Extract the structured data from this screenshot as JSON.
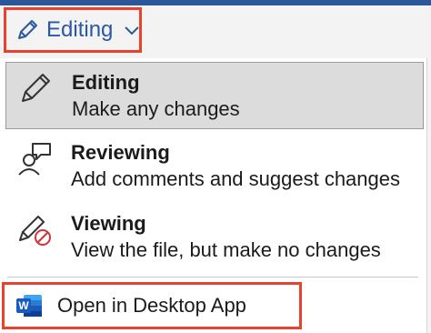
{
  "mode_button": {
    "label": "Editing",
    "icon": "pencil-icon",
    "chevron_icon": "chevron-down-icon",
    "accent_color": "#2a57a6",
    "highlight_color": "#e8422f"
  },
  "menu": {
    "items": [
      {
        "title": "Editing",
        "description": "Make any changes",
        "icon": "pencil-icon",
        "selected": true
      },
      {
        "title": "Reviewing",
        "description": "Add comments and suggest changes",
        "icon": "reviewer-comment-icon",
        "selected": false
      },
      {
        "title": "Viewing",
        "description": "View the file, but make no changes",
        "icon": "pencil-prohibited-icon",
        "selected": false
      }
    ],
    "desktop_action": {
      "label": "Open in Desktop App",
      "icon": "word-app-icon",
      "icon_letter": "W",
      "highlight_color": "#e8422f"
    }
  }
}
